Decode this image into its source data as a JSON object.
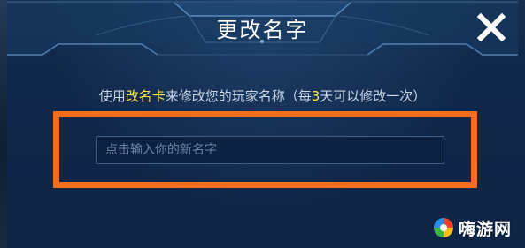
{
  "dialog": {
    "title": "更改名字",
    "instruction": {
      "part1": "使用",
      "card_name": "改名卡",
      "part2": "来修改您的玩家名称（每",
      "days": "3",
      "part3": "天可以修改一次）"
    },
    "name_input": {
      "placeholder": "点击输入你的新名字",
      "value": ""
    }
  },
  "watermark": {
    "text": "嗨游网"
  },
  "colors": {
    "dialog_bg": "#10284a",
    "highlight_text": "#ffe24a",
    "annotation_frame": "#f26f1f",
    "title_text": "#ffffff"
  },
  "icons": {
    "close": "close-icon",
    "watermark_logo": "haiyou-logo-icon"
  }
}
